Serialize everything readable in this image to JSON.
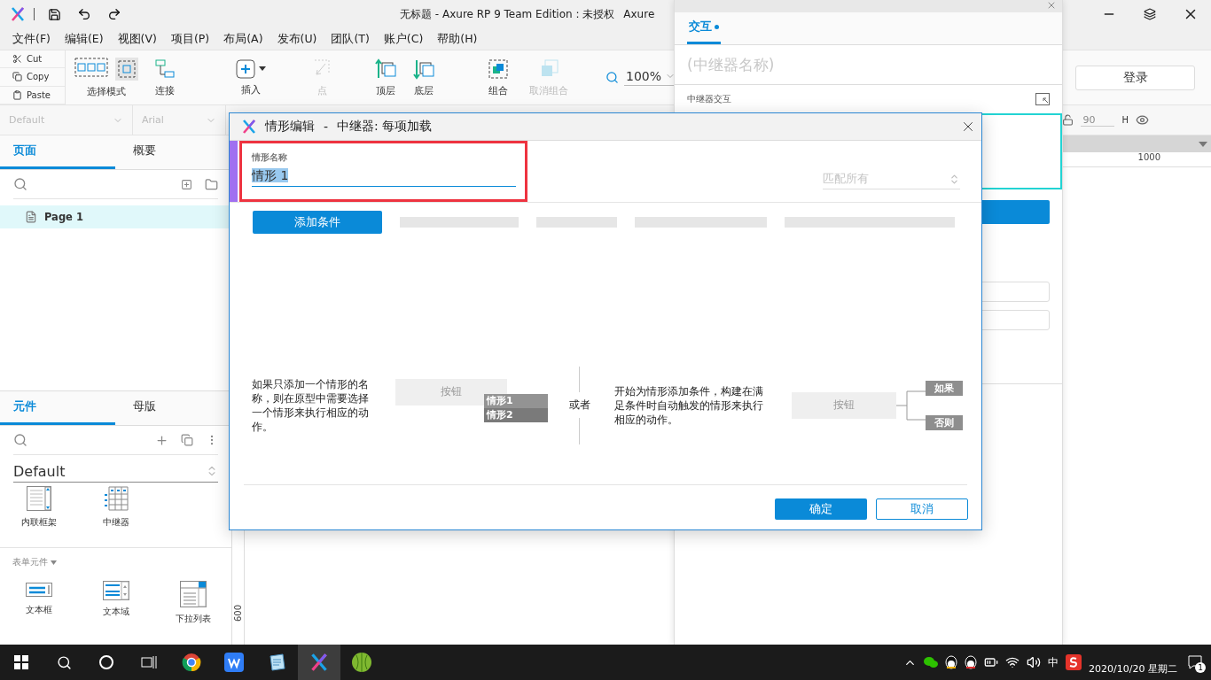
{
  "titlebar": {
    "title": "无标题 - Axure RP 9 Team Edition : 未授权",
    "title_extra": "Axure"
  },
  "menu": [
    "文件(F)",
    "编辑(E)",
    "视图(V)",
    "项目(P)",
    "布局(A)",
    "发布(U)",
    "团队(T)",
    "账户(C)",
    "帮助(H)"
  ],
  "clipboard": [
    {
      "kind": "cut",
      "label": "Cut"
    },
    {
      "kind": "copy",
      "label": "Copy"
    },
    {
      "kind": "paste",
      "label": "Paste"
    }
  ],
  "toolbar": [
    {
      "kind": "select",
      "label": "选择模式",
      "disabled": false
    },
    {
      "kind": "connect",
      "label": "连接",
      "disabled": false
    },
    {
      "kind": "insert",
      "label": "插入",
      "disabled": false
    },
    {
      "kind": "point",
      "label": "点",
      "disabled": true
    },
    {
      "kind": "front",
      "label": "顶层",
      "disabled": false
    },
    {
      "kind": "back",
      "label": "底层",
      "disabled": false
    },
    {
      "kind": "group",
      "label": "组合",
      "disabled": false
    },
    {
      "kind": "ungroup",
      "label": "取消组合",
      "disabled": true
    }
  ],
  "zoom": "100%",
  "login_button": "登录",
  "format_bar": {
    "style": "Default",
    "font": "Arial",
    "size_value": "90",
    "height_label": "H"
  },
  "ruler": {
    "top_label": "1000",
    "left_label": "600"
  },
  "pages_panel": {
    "tabs": [
      {
        "label": "页面",
        "selected": true
      },
      {
        "label": "概要",
        "selected": false
      }
    ],
    "pages": [
      {
        "name": "Page 1",
        "selected": true
      }
    ]
  },
  "widgets_panel": {
    "tabs": [
      {
        "label": "元件",
        "selected": true
      },
      {
        "label": "母版",
        "selected": false
      }
    ],
    "library": "Default",
    "widgets": [
      {
        "kind": "inline-frame",
        "label": "内联框架"
      },
      {
        "kind": "repeater",
        "label": "中继器"
      }
    ],
    "section": "表单元件",
    "form_widgets": [
      {
        "kind": "text-field",
        "label": "文本框"
      },
      {
        "kind": "text-area",
        "label": "文本域"
      },
      {
        "kind": "dropdown",
        "label": "下拉列表"
      }
    ]
  },
  "interaction_panel": {
    "tabs": [
      {
        "label": "交互",
        "selected": true
      }
    ],
    "name_placeholder": "(中继器名称)",
    "section": "中继器交互"
  },
  "dialog": {
    "title": "情形编辑",
    "separator": "-",
    "subtitle": "中继器: 每项加载",
    "name_label": "情形名称",
    "name_value": "情形 1",
    "name_selected": true,
    "match": "匹配所有",
    "add_condition": "添加条件",
    "hint_left": "如果只添加一个情形的名称，则在原型中需要选择一个情形来执行相应的动作。",
    "demo_button": "按钮",
    "demo_cases": [
      "情形1",
      "情形2"
    ],
    "or": "或者",
    "hint_right": "开始为情形添加条件，构建在满足条件时自动触发的情形来执行相应的动作。",
    "demo_button_2": "按钮",
    "branches": [
      "如果",
      "否则"
    ],
    "ok": "确定",
    "cancel": "取消"
  },
  "taskbar": {
    "apps": [
      {
        "kind": "chrome",
        "active": false
      },
      {
        "kind": "wps",
        "active": false
      },
      {
        "kind": "notepad",
        "active": false
      },
      {
        "kind": "axure",
        "active": true
      },
      {
        "kind": "melon",
        "active": false
      }
    ],
    "ime": "中",
    "date": "2020/10/20 星期二",
    "notifications": "1"
  }
}
